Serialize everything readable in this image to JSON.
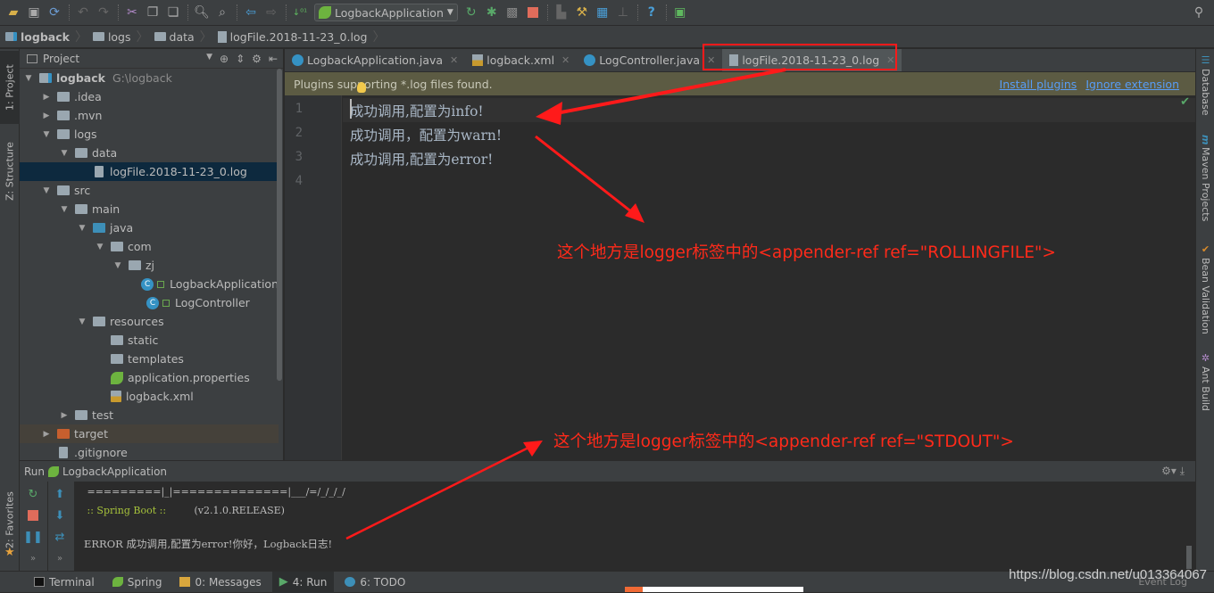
{
  "toolbar": {
    "run_config": "LogbackApplication",
    "icons": [
      "open-icon",
      "save-icon",
      "sync-icon",
      "undo-icon",
      "redo-icon",
      "cut-icon",
      "copy-icon",
      "paste-icon",
      "find-icon",
      "replace-icon",
      "back-icon",
      "forward-icon",
      "build-icon",
      "run-config",
      "rerun-icon",
      "debug-icon",
      "coverage-icon",
      "stop-icon",
      "project-structure-icon",
      "settings-icon",
      "sdk-icon",
      "help-icon",
      "plugin-icon"
    ]
  },
  "breadcrumb": [
    "logback",
    "logs",
    "data",
    "logFile.2018-11-23_0.log"
  ],
  "left_stripe": {
    "project": "1: Project",
    "structure": "Z: Structure",
    "favorites": "2: Favorites"
  },
  "project_panel": {
    "title": "Project",
    "tree": [
      {
        "label": "logback",
        "extra": "G:\\logback",
        "level": 0,
        "expanded": true,
        "icon": "module"
      },
      {
        "label": ".idea",
        "level": 1,
        "expanded": false,
        "icon": "folder"
      },
      {
        "label": ".mvn",
        "level": 1,
        "expanded": false,
        "icon": "folder"
      },
      {
        "label": "logs",
        "level": 1,
        "expanded": true,
        "icon": "folder"
      },
      {
        "label": "data",
        "level": 2,
        "expanded": true,
        "icon": "folder"
      },
      {
        "label": "logFile.2018-11-23_0.log",
        "level": 3,
        "icon": "file",
        "selected": true
      },
      {
        "label": "src",
        "level": 1,
        "expanded": true,
        "icon": "folder"
      },
      {
        "label": "main",
        "level": 2,
        "expanded": true,
        "icon": "folder"
      },
      {
        "label": "java",
        "level": 3,
        "expanded": true,
        "icon": "source-folder"
      },
      {
        "label": "com",
        "level": 4,
        "expanded": true,
        "icon": "package"
      },
      {
        "label": "zj",
        "level": 5,
        "expanded": true,
        "icon": "package"
      },
      {
        "label": "LogbackApplication",
        "level": 6,
        "icon": "spring-class"
      },
      {
        "label": "LogController",
        "level": 6,
        "icon": "class"
      },
      {
        "label": "resources",
        "level": 3,
        "expanded": true,
        "icon": "resources-folder"
      },
      {
        "label": "static",
        "level": 4,
        "icon": "folder"
      },
      {
        "label": "templates",
        "level": 4,
        "icon": "folder"
      },
      {
        "label": "application.properties",
        "level": 4,
        "icon": "spring-properties"
      },
      {
        "label": "logback.xml",
        "level": 4,
        "icon": "xml"
      },
      {
        "label": "test",
        "level": 2,
        "expanded": false,
        "icon": "folder"
      },
      {
        "label": "target",
        "level": 1,
        "expanded": false,
        "icon": "excluded-folder"
      },
      {
        "label": ".gitignore",
        "level": 1,
        "icon": "file"
      }
    ]
  },
  "editor_tabs": [
    {
      "label": "LogbackApplication.java",
      "icon": "spring-class"
    },
    {
      "label": "logback.xml",
      "icon": "xml"
    },
    {
      "label": "LogController.java",
      "icon": "class"
    },
    {
      "label": "logFile.2018-11-23_0.log",
      "icon": "file",
      "active": true
    }
  ],
  "banner": {
    "text": "Plugins supporting *.log files found.",
    "install": "Install plugins",
    "ignore": "Ignore extension"
  },
  "editor": {
    "line_numbers": [
      "1",
      "2",
      "3",
      "4"
    ],
    "lines": [
      "成功调用,配置为info!",
      "成功调用，配置为warn!",
      "成功调用,配置为error!",
      ""
    ]
  },
  "annotations": {
    "rolling": "这个地方是logger标签中的<appender-ref ref=\"ROLLINGFILE\">",
    "stdout": "这个地方是logger标签中的<appender-ref ref=\"STDOUT\">",
    "color": "#ff2a1a"
  },
  "right_stripe": [
    "Database",
    "Maven Projects",
    "Bean Validation",
    "Ant Build"
  ],
  "run_panel": {
    "label": "Run",
    "config": "LogbackApplication",
    "console": {
      "banner_line": " =========|_|==============|___/=/_/_/_/",
      "spring_label": " :: Spring Boot :: ",
      "version": "        (v2.1.0.RELEASE)",
      "error_line": "ERROR 成功调用,配置为error!你好，Logback日志!"
    }
  },
  "bottom_tabs": [
    {
      "label": "Terminal",
      "icon": "terminal-icon"
    },
    {
      "label": "Spring",
      "icon": "spring-icon"
    },
    {
      "label": "0: Messages",
      "icon": "messages-icon"
    },
    {
      "label": "4: Run",
      "icon": "run-icon",
      "active": true
    },
    {
      "label": "6: TODO",
      "icon": "todo-icon"
    }
  ],
  "watermark": "https://blog.csdn.net/u013364067",
  "event_log": "Event Log"
}
